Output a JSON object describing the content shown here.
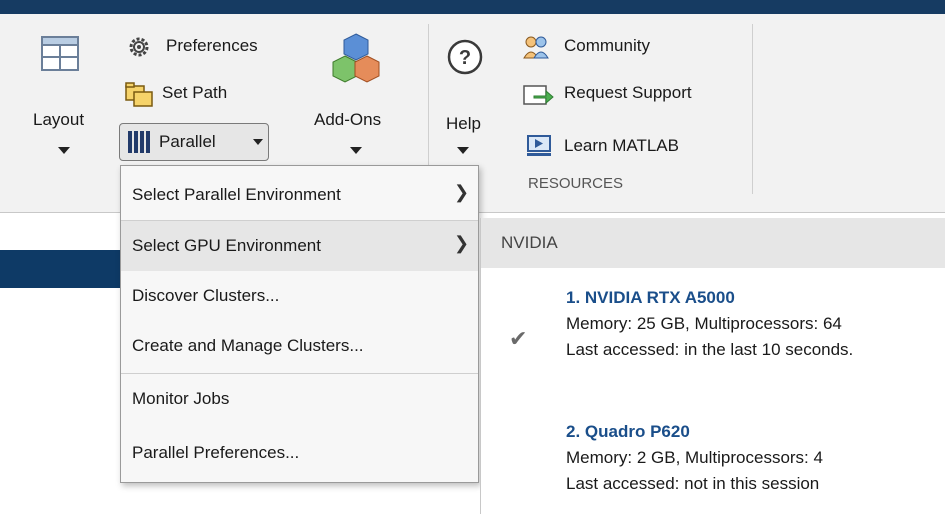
{
  "ribbon": {
    "layout_label": "Layout",
    "preferences_label": "Preferences",
    "set_path_label": "Set Path",
    "parallel_label": "Parallel",
    "addons_label": "Add-Ons",
    "help_label": "Help",
    "community_label": "Community",
    "request_support_label": "Request Support",
    "learn_matlab_label": "Learn MATLAB",
    "resources_group_label": "RESOURCES"
  },
  "parallel_menu": {
    "items": [
      {
        "label": "Select Parallel Environment",
        "has_submenu": true
      },
      {
        "label": "Select GPU Environment",
        "has_submenu": true,
        "highlighted": true
      },
      {
        "label": "Discover Clusters..."
      },
      {
        "label": "Create and Manage Clusters..."
      },
      {
        "label": "Monitor Jobs"
      },
      {
        "label": "Parallel Preferences..."
      }
    ]
  },
  "gpu_submenu": {
    "header": "NVIDIA",
    "devices": [
      {
        "name": "1. NVIDIA RTX A5000",
        "memory": "Memory: 25 GB, Multiprocessors: 64",
        "last_accessed": "Last accessed: in the last 10 seconds.",
        "selected": true
      },
      {
        "name": "2. Quadro P620",
        "memory": "Memory: 2 GB, Multiprocessors: 4",
        "last_accessed": "Last accessed: not in this session",
        "selected": false
      }
    ]
  },
  "colors": {
    "title_bar": "#163b62",
    "ribbon_bg": "#f2f2f2",
    "link_blue": "#1a4e8a",
    "highlight": "#e6e6e6"
  },
  "icons": [
    "layout-icon",
    "gear-icon",
    "folder-path-icon",
    "parallel-bars-icon",
    "addons-cubes-icon",
    "help-icon",
    "community-icon",
    "request-support-icon",
    "learn-matlab-icon",
    "checkmark-icon",
    "chevron-right-icon",
    "chevron-down-icon"
  ]
}
